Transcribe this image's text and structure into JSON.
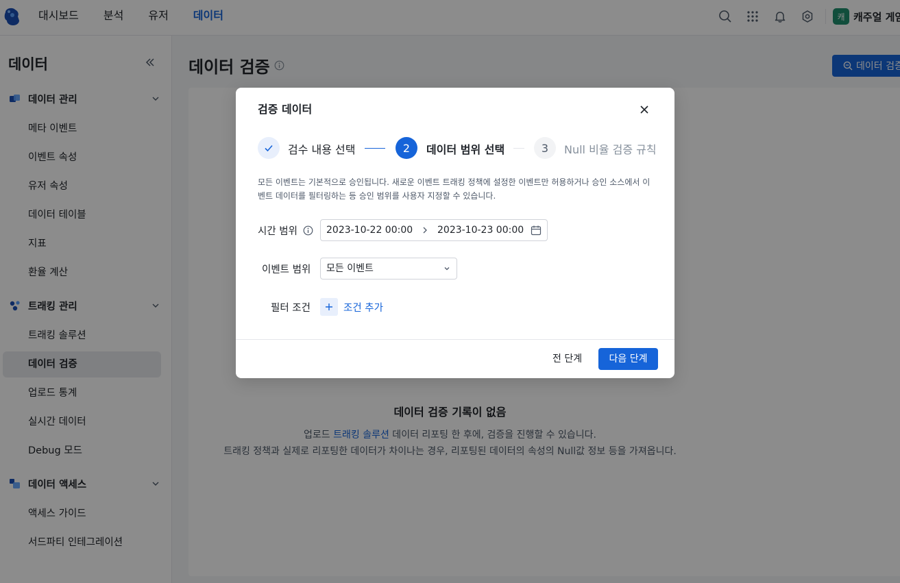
{
  "topbar": {
    "nav": [
      {
        "label": "대시보드",
        "active": false
      },
      {
        "label": "분석",
        "active": false
      },
      {
        "label": "유저",
        "active": false
      },
      {
        "label": "데이터",
        "active": true
      }
    ],
    "workspace": {
      "avatar": "캐",
      "name": "캐주얼 게임"
    }
  },
  "sidebar": {
    "title": "데이터",
    "groups": [
      {
        "label": "데이터 관리",
        "icon": "data-management-icon",
        "items": [
          "메타 이벤트",
          "이벤트 속성",
          "유저 속성",
          "데이터 테이블",
          "지표",
          "환율 계산"
        ]
      },
      {
        "label": "트래킹 관리",
        "icon": "tracking-management-icon",
        "items": [
          "트래킹 솔루션",
          "데이터 검증",
          "업로드 통계",
          "실시간 데이터",
          "Debug 모드"
        ]
      },
      {
        "label": "데이터 액세스",
        "icon": "data-access-icon",
        "items": [
          "액세스 가이드",
          "서드파티 인테그레이션"
        ]
      }
    ],
    "active_item": "데이터 검증"
  },
  "main": {
    "title": "데이터 검증",
    "action_button": "데이터 검증",
    "empty": {
      "title": "데이터 검증 기록이 없음",
      "line1_prefix": "업로드 ",
      "line1_link": "트래킹 솔루션",
      "line1_suffix": " 데이터 리포팅 한 후에, 검증을 진행할 수 있습니다.",
      "line2": "트래킹 정책과 실제로 리포팅한 데이터가 차이나는 경우, 리포팅된 데이터의 속성의 Null값 정보 등을 가져옵니다."
    }
  },
  "modal": {
    "title": "검증 데이터",
    "steps": [
      {
        "index": "1",
        "label": "검수 내용 선택",
        "status": "done"
      },
      {
        "index": "2",
        "label": "데이터 범위 선택",
        "status": "active"
      },
      {
        "index": "3",
        "label": "Null 비율 검증 규칙",
        "status": "pending"
      }
    ],
    "description": "모든 이벤트는 기본적으로 승인됩니다. 새로운 이벤트 트래킹 정책에 설정한 이벤트만 허용하거나 승인 소스에서 이벤트 데이터를 필터링하는 등 승인 범위를 사용자 지정할 수 있습니다.",
    "time_range": {
      "label": "시간 범위",
      "start": "2023-10-22 00:00",
      "end": "2023-10-23 00:00"
    },
    "event_range": {
      "label": "이벤트 범위",
      "value": "모든 이벤트"
    },
    "filter": {
      "label": "필터 조건",
      "add_label": "조건 추가"
    },
    "footer": {
      "prev": "전 단계",
      "next": "다음 단계"
    }
  },
  "colors": {
    "primary": "#1664d9",
    "overlay": "rgba(0,0,0,0.45)"
  }
}
